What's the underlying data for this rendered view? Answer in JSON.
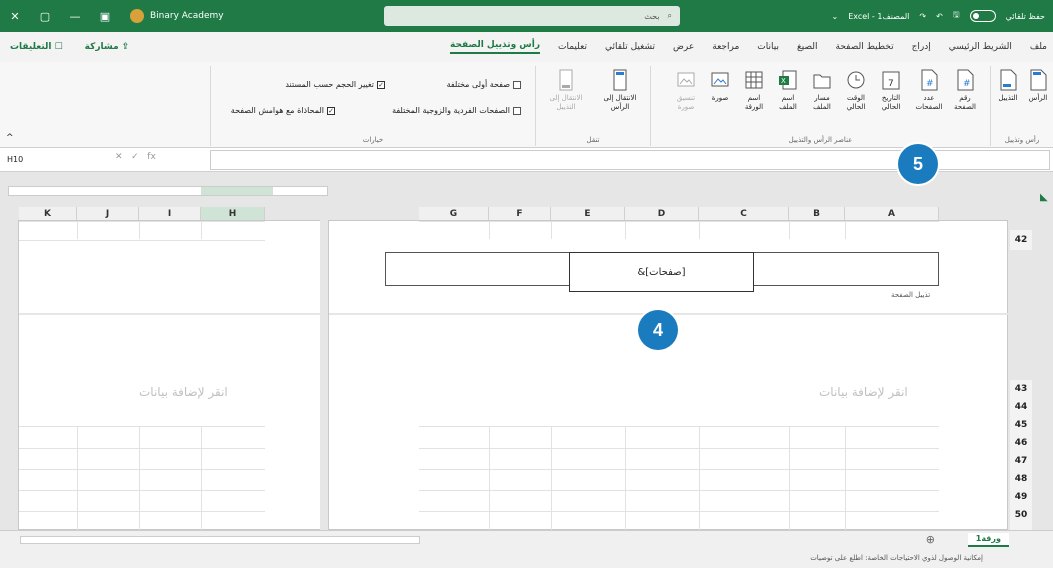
{
  "titlebar": {
    "account": "Binary Academy",
    "search_placeholder": "بحث",
    "excel_title": "Excel - 1المصنف",
    "autosave": "حفظ تلقائي"
  },
  "tabs": [
    {
      "label": "ملف"
    },
    {
      "label": "الشريط الرئيسي"
    },
    {
      "label": "إدراج"
    },
    {
      "label": "تخطيط الصفحة"
    },
    {
      "label": "الصيغ"
    },
    {
      "label": "بيانات"
    },
    {
      "label": "مراجعة"
    },
    {
      "label": "عرض"
    },
    {
      "label": "تشغيل تلقائي"
    },
    {
      "label": "تعليمات"
    },
    {
      "label": "رأس وتذييل الصفحة"
    }
  ],
  "tabs_left": {
    "comments": "التعليقات",
    "share": "مشاركة"
  },
  "ribbon": {
    "groups": {
      "header_footer": "رأس وتذييل",
      "elements": "عناصر الرأس والتذييل",
      "navigation": "تنقل",
      "options": "خيارات"
    },
    "header_footer_buttons": [
      {
        "label": "الرأس"
      },
      {
        "label": "التذييل"
      }
    ],
    "element_buttons": [
      {
        "label": "رقم الصفحة"
      },
      {
        "label": "عدد الصفحات"
      },
      {
        "label": "التاريخ الحالي"
      },
      {
        "label": "الوقت الحالي"
      },
      {
        "label": "مسار الملف"
      },
      {
        "label": "اسم الملف"
      },
      {
        "label": "اسم الورقة"
      },
      {
        "label": "صورة"
      },
      {
        "label": "تنسيق صورة"
      }
    ],
    "nav_buttons": [
      {
        "label": "الانتقال إلى الرأس"
      },
      {
        "label": "الانتقال إلى التذييل"
      }
    ],
    "options": [
      {
        "label": "صفحة أولى مختلفة",
        "checked": false
      },
      {
        "label": "الصفحات الفردية والزوجية المختلفة",
        "checked": false
      },
      {
        "label": "تغيير الحجم حسب المستند",
        "checked": true
      },
      {
        "label": "المحاذاة مع هوامش الصفحة",
        "checked": true
      }
    ]
  },
  "formula": {
    "namebox": "H10",
    "fx": "fx",
    "value": ""
  },
  "sheet": {
    "cols_right": [
      "G",
      "F",
      "E",
      "D",
      "C",
      "B",
      "A"
    ],
    "cols_left": [
      "K",
      "J",
      "I",
      "H"
    ],
    "header_field": "&[صفحات]",
    "footer_label": "تذييل الصفحة",
    "click_to_add": "انقر لإضافة بيانات",
    "rows_top": [
      "42"
    ],
    "rows_bottom": [
      "43",
      "44",
      "45",
      "46",
      "47",
      "48",
      "49",
      "50"
    ]
  },
  "badges": {
    "b4": "4",
    "b5": "5"
  },
  "statusbar": {
    "sheet_tab": "ورقة1",
    "text": "إمكانية الوصول لذوي الاحتياجات الخاصة: اطلع على توصيات"
  }
}
